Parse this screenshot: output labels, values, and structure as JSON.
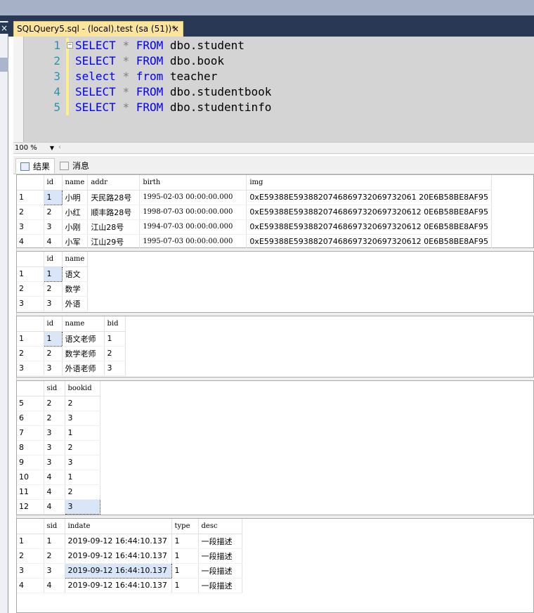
{
  "window": {
    "doc_tab_title": "SQLQuery5.sql - (local).test (sa (51))*",
    "close_glyph": "×"
  },
  "editor": {
    "lines": [
      {
        "num": "1",
        "kw1": "SELECT",
        "star": "*",
        "kw2": "FROM",
        "rest": "dbo.student"
      },
      {
        "num": "2",
        "kw1": "SELECT",
        "star": "*",
        "kw2": "FROM",
        "rest": "dbo.book"
      },
      {
        "num": "3",
        "kw1": "select",
        "star": "*",
        "kw2": "from",
        "rest": "teacher"
      },
      {
        "num": "4",
        "kw1": "SELECT",
        "star": "*",
        "kw2": "FROM",
        "rest": "dbo.studentbook"
      },
      {
        "num": "5",
        "kw1": "SELECT",
        "star": "*",
        "kw2": "FROM",
        "rest": "dbo.studentinfo"
      }
    ],
    "collapse_glyph": "−",
    "keyword_color": "#0000ff",
    "line_number_color": "#2b91af"
  },
  "zoom": {
    "value": "100 %"
  },
  "result_tabs": {
    "results": "结果",
    "messages": "消息"
  },
  "grids": {
    "student": {
      "columns": [
        "id",
        "name",
        "addr",
        "birth",
        "img"
      ],
      "rows": [
        [
          "1",
          "1",
          "小明",
          "天民路28号",
          "1995-02-03 00:00:00.000",
          "0xE59388E5938820746869732069732061 20E6B58BE8AF95"
        ],
        [
          "2",
          "2",
          "小红",
          "顺丰路28号",
          "1998-07-03 00:00:00.000",
          "0xE59388E59388207468697320697320612 0E6B58BE8AF95"
        ],
        [
          "3",
          "3",
          "小刚",
          "江山28号",
          "1994-07-03 00:00:00.000",
          "0xE59388E59388207468697320697320612 0E6B58BE8AF95"
        ],
        [
          "4",
          "4",
          "小军",
          "江山29号",
          "1995-07-03 00:00:00.000",
          "0xE59388E59388207468697320697320612 0E6B58BE8AF95"
        ]
      ]
    },
    "book": {
      "columns": [
        "id",
        "name"
      ],
      "rows": [
        [
          "1",
          "1",
          "语文"
        ],
        [
          "2",
          "2",
          "数学"
        ],
        [
          "3",
          "3",
          "外语"
        ]
      ]
    },
    "teacher": {
      "columns": [
        "id",
        "name",
        "bid"
      ],
      "rows": [
        [
          "1",
          "1",
          "语文老师",
          "1"
        ],
        [
          "2",
          "2",
          "数学老师",
          "2"
        ],
        [
          "3",
          "3",
          "外语老师",
          "3"
        ]
      ]
    },
    "studentbook": {
      "columns": [
        "sid",
        "bookid"
      ],
      "rows": [
        [
          "5",
          "2",
          "2"
        ],
        [
          "6",
          "2",
          "3"
        ],
        [
          "7",
          "3",
          "1"
        ],
        [
          "8",
          "3",
          "2"
        ],
        [
          "9",
          "3",
          "3"
        ],
        [
          "10",
          "4",
          "1"
        ],
        [
          "11",
          "4",
          "2"
        ],
        [
          "12",
          "4",
          "3"
        ]
      ]
    },
    "studentinfo": {
      "columns": [
        "sid",
        "indate",
        "type",
        "desc"
      ],
      "rows": [
        [
          "1",
          "1",
          "2019-09-12 16:44:10.137",
          "1",
          "一段描述"
        ],
        [
          "2",
          "2",
          "2019-09-12 16:44:10.137",
          "1",
          "一段描述"
        ],
        [
          "3",
          "3",
          "2019-09-12 16:44:10.137",
          "1",
          "一段描述"
        ],
        [
          "4",
          "4",
          "2019-09-12 16:44:10.137",
          "1",
          "一段描述"
        ]
      ]
    }
  }
}
